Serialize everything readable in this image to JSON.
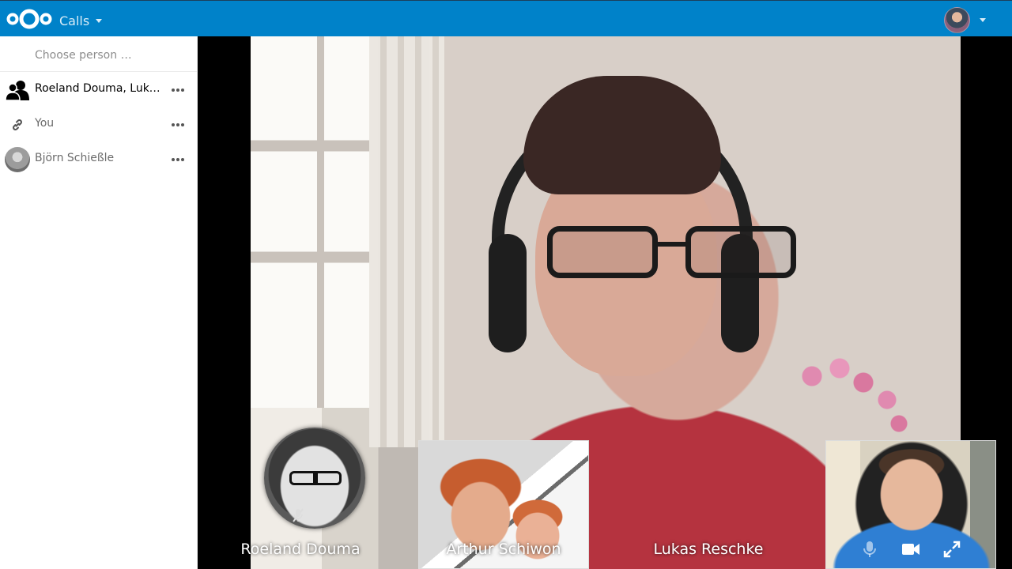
{
  "header": {
    "app_name": "Calls"
  },
  "search": {
    "placeholder": "Choose person …"
  },
  "conversations": [
    {
      "name": "Roeland Douma, Lukas Reschke, Arthur Schiwon",
      "icon": "group-icon",
      "active": true
    },
    {
      "name": "You",
      "icon": "link-icon",
      "active": false
    },
    {
      "name": "Björn Schießle",
      "icon": "avatar",
      "active": false
    }
  ],
  "participants": [
    {
      "name": "Roeland Douma",
      "view": "avatar",
      "muted": true
    },
    {
      "name": "Arthur Schiwon",
      "view": "video"
    },
    {
      "name": "Lukas Reschke",
      "view": "promoted"
    }
  ],
  "self_controls": [
    "microphone-icon",
    "video-camera-icon",
    "fullscreen-icon"
  ],
  "colors": {
    "header_bg": "#0082c9",
    "sidebar_bg": "#ffffff",
    "stage_bg": "#000000"
  }
}
